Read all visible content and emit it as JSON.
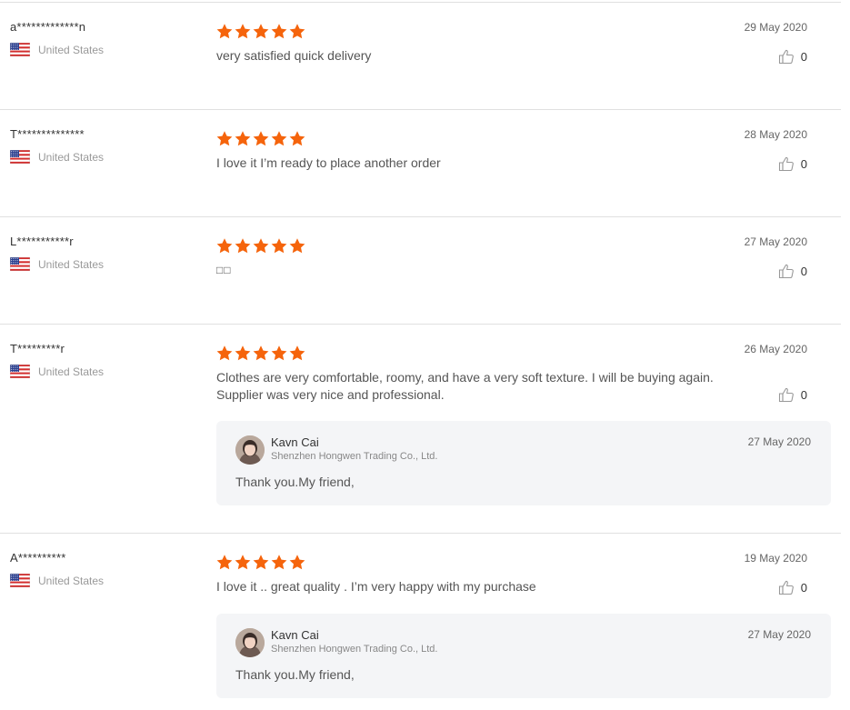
{
  "reviews": [
    {
      "reviewer": "a*************n",
      "country": "United States",
      "rating": 5,
      "text": "very satisfied quick delivery",
      "date": "29 May 2020",
      "helpful_count": "0"
    },
    {
      "reviewer": "T**************",
      "country": "United States",
      "rating": 5,
      "text": "I love it I’m ready to place another order",
      "date": "28 May 2020",
      "helpful_count": "0"
    },
    {
      "reviewer": "L***********r",
      "country": "United States",
      "rating": 5,
      "text": "□□",
      "date": "27 May 2020",
      "helpful_count": "0"
    },
    {
      "reviewer": "T*********r",
      "country": "United States",
      "rating": 5,
      "text": "Clothes are very comfortable, roomy, and have a very soft texture. I will be buying again. Supplier was very nice and professional.",
      "date": "26 May 2020",
      "helpful_count": "0",
      "reply": {
        "seller_name": "Kavn Cai",
        "store": "Shenzhen Hongwen Trading Co., Ltd.",
        "date": "27 May 2020",
        "text": "Thank you.My friend,"
      }
    },
    {
      "reviewer": "A**********",
      "country": "United States",
      "rating": 5,
      "text": "I love it .. great quality . I’m very happy with my purchase",
      "date": "19 May 2020",
      "helpful_count": "0",
      "reply": {
        "seller_name": "Kavn Cai",
        "store": "Shenzhen Hongwen Trading Co., Ltd.",
        "date": "27 May 2020",
        "text": "Thank you.My friend,"
      }
    }
  ],
  "icons": {
    "star": "star-icon",
    "thumb": "thumbs-up-icon",
    "flag": "us-flag-icon"
  },
  "colors": {
    "star": "#f5640c",
    "divider": "#e0e0e0",
    "reply_bg": "#f4f5f7"
  }
}
